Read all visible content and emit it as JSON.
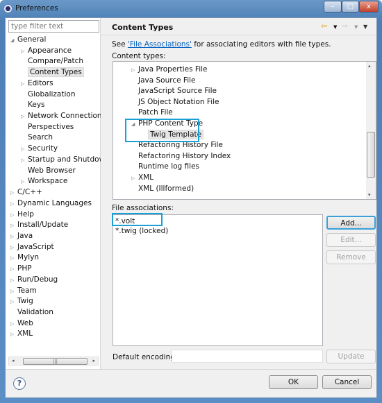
{
  "window": {
    "title": "Preferences",
    "buttons": {
      "minimize": "–",
      "maximize": "□",
      "close": "x"
    }
  },
  "filter": {
    "placeholder": "type filter text",
    "value": ""
  },
  "tree": [
    {
      "label": "General",
      "level": 0,
      "state": "expanded"
    },
    {
      "label": "Appearance",
      "level": 1,
      "state": "collapsed"
    },
    {
      "label": "Compare/Patch",
      "level": 1,
      "state": "leaf"
    },
    {
      "label": "Content Types",
      "level": 1,
      "state": "leaf",
      "selected": true
    },
    {
      "label": "Editors",
      "level": 1,
      "state": "collapsed"
    },
    {
      "label": "Globalization",
      "level": 1,
      "state": "leaf"
    },
    {
      "label": "Keys",
      "level": 1,
      "state": "leaf"
    },
    {
      "label": "Network Connections",
      "level": 1,
      "state": "collapsed"
    },
    {
      "label": "Perspectives",
      "level": 1,
      "state": "leaf"
    },
    {
      "label": "Search",
      "level": 1,
      "state": "leaf"
    },
    {
      "label": "Security",
      "level": 1,
      "state": "collapsed"
    },
    {
      "label": "Startup and Shutdown",
      "level": 1,
      "state": "collapsed"
    },
    {
      "label": "Web Browser",
      "level": 1,
      "state": "leaf"
    },
    {
      "label": "Workspace",
      "level": 1,
      "state": "collapsed"
    },
    {
      "label": "C/C++",
      "level": 0,
      "state": "collapsed"
    },
    {
      "label": "Dynamic Languages",
      "level": 0,
      "state": "collapsed"
    },
    {
      "label": "Help",
      "level": 0,
      "state": "collapsed"
    },
    {
      "label": "Install/Update",
      "level": 0,
      "state": "collapsed"
    },
    {
      "label": "Java",
      "level": 0,
      "state": "collapsed"
    },
    {
      "label": "JavaScript",
      "level": 0,
      "state": "collapsed"
    },
    {
      "label": "Mylyn",
      "level": 0,
      "state": "collapsed"
    },
    {
      "label": "PHP",
      "level": 0,
      "state": "collapsed"
    },
    {
      "label": "Run/Debug",
      "level": 0,
      "state": "collapsed"
    },
    {
      "label": "Team",
      "level": 0,
      "state": "collapsed"
    },
    {
      "label": "Twig",
      "level": 0,
      "state": "collapsed"
    },
    {
      "label": "Validation",
      "level": 0,
      "state": "leaf"
    },
    {
      "label": "Web",
      "level": 0,
      "state": "collapsed"
    },
    {
      "label": "XML",
      "level": 0,
      "state": "collapsed"
    }
  ],
  "page": {
    "title": "Content Types",
    "intro_before": "See ",
    "intro_link": "'File Associations'",
    "intro_after": " for associating editors with file types.",
    "content_types_label": "Content types:",
    "content_types": [
      {
        "label": "Java Properties File",
        "level": 1,
        "state": "collapsed"
      },
      {
        "label": "Java Source File",
        "level": 1,
        "state": "leaf"
      },
      {
        "label": "JavaScript Source File",
        "level": 1,
        "state": "leaf"
      },
      {
        "label": "JS Object Notation File",
        "level": 1,
        "state": "leaf"
      },
      {
        "label": "Patch File",
        "level": 1,
        "state": "leaf"
      },
      {
        "label": "PHP Content Type",
        "level": 1,
        "state": "expanded"
      },
      {
        "label": "Twig Template",
        "level": 2,
        "state": "leaf",
        "selected": true
      },
      {
        "label": "Refactoring History File",
        "level": 1,
        "state": "leaf"
      },
      {
        "label": "Refactoring History Index",
        "level": 1,
        "state": "leaf"
      },
      {
        "label": "Runtime log files",
        "level": 1,
        "state": "leaf"
      },
      {
        "label": "XML",
        "level": 1,
        "state": "collapsed"
      },
      {
        "label": "XML (Illformed)",
        "level": 1,
        "state": "leaf"
      }
    ],
    "file_assoc_label": "File associations:",
    "file_assocs": [
      "*.volt",
      "*.twig (locked)"
    ],
    "add": "Add...",
    "edit": "Edit...",
    "remove": "Remove",
    "encoding_label": "Default encoding:",
    "encoding_value": "",
    "update": "Update"
  },
  "footer": {
    "help": "?",
    "ok": "OK",
    "cancel": "Cancel"
  },
  "colors": {
    "highlight": "#19a1d6",
    "link": "#0563c1"
  }
}
